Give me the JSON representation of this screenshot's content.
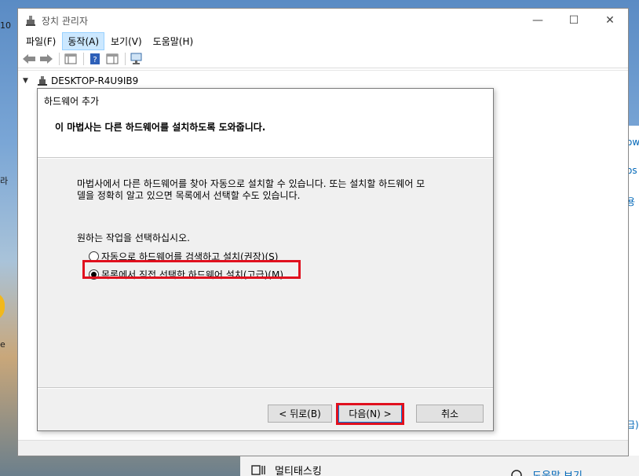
{
  "desktop": {
    "left_num": "10",
    "left_char": "라",
    "left_char2": "e",
    "right_fragments": [
      "ow",
      "os",
      "용",
      "급)"
    ]
  },
  "window": {
    "title": "장치 관리자",
    "controls": {
      "minimize": "—",
      "maximize": "☐",
      "close": "✕"
    },
    "menu": [
      "파일(F)",
      "동작(A)",
      "보기(V)",
      "도움말(H)"
    ],
    "tree_root": "DESKTOP-R4U9IB9"
  },
  "dialog": {
    "title": "하드웨어 추가",
    "header": "이 마법사는 다른 하드웨어를 설치하도록 도와줍니다.",
    "description": "마법사에서 다른 하드웨어를 찾아 자동으로 설치할 수 있습니다. 또는 설치할 하드웨어 모델을 정확히 알고 있으면 목록에서 선택할 수도 있습니다.",
    "desc_line1": "마법사에서 다른 하드웨어를 찾아 자동으로 설치할 수 있습니다. 또는 설치할 하드웨어 모",
    "desc_line2": "델을 정확히 알고 있으면 목록에서 선택할 수도 있습니다.",
    "prompt": "원하는 작업을 선택하십시오.",
    "options": [
      {
        "label": "자동으로 하드웨어를 검색하고 설치(권장)(S)",
        "selected": false
      },
      {
        "label": "목록에서 직접 선택한 하드웨어 설치(고급)(M)",
        "selected": true
      }
    ],
    "buttons": {
      "back": "< 뒤로(B)",
      "next": "다음(N) >",
      "cancel": "취소"
    },
    "highlight_color": "#e0101e"
  },
  "settings": {
    "multitasking": "멀티태스킹",
    "help": "도움말 보기"
  }
}
